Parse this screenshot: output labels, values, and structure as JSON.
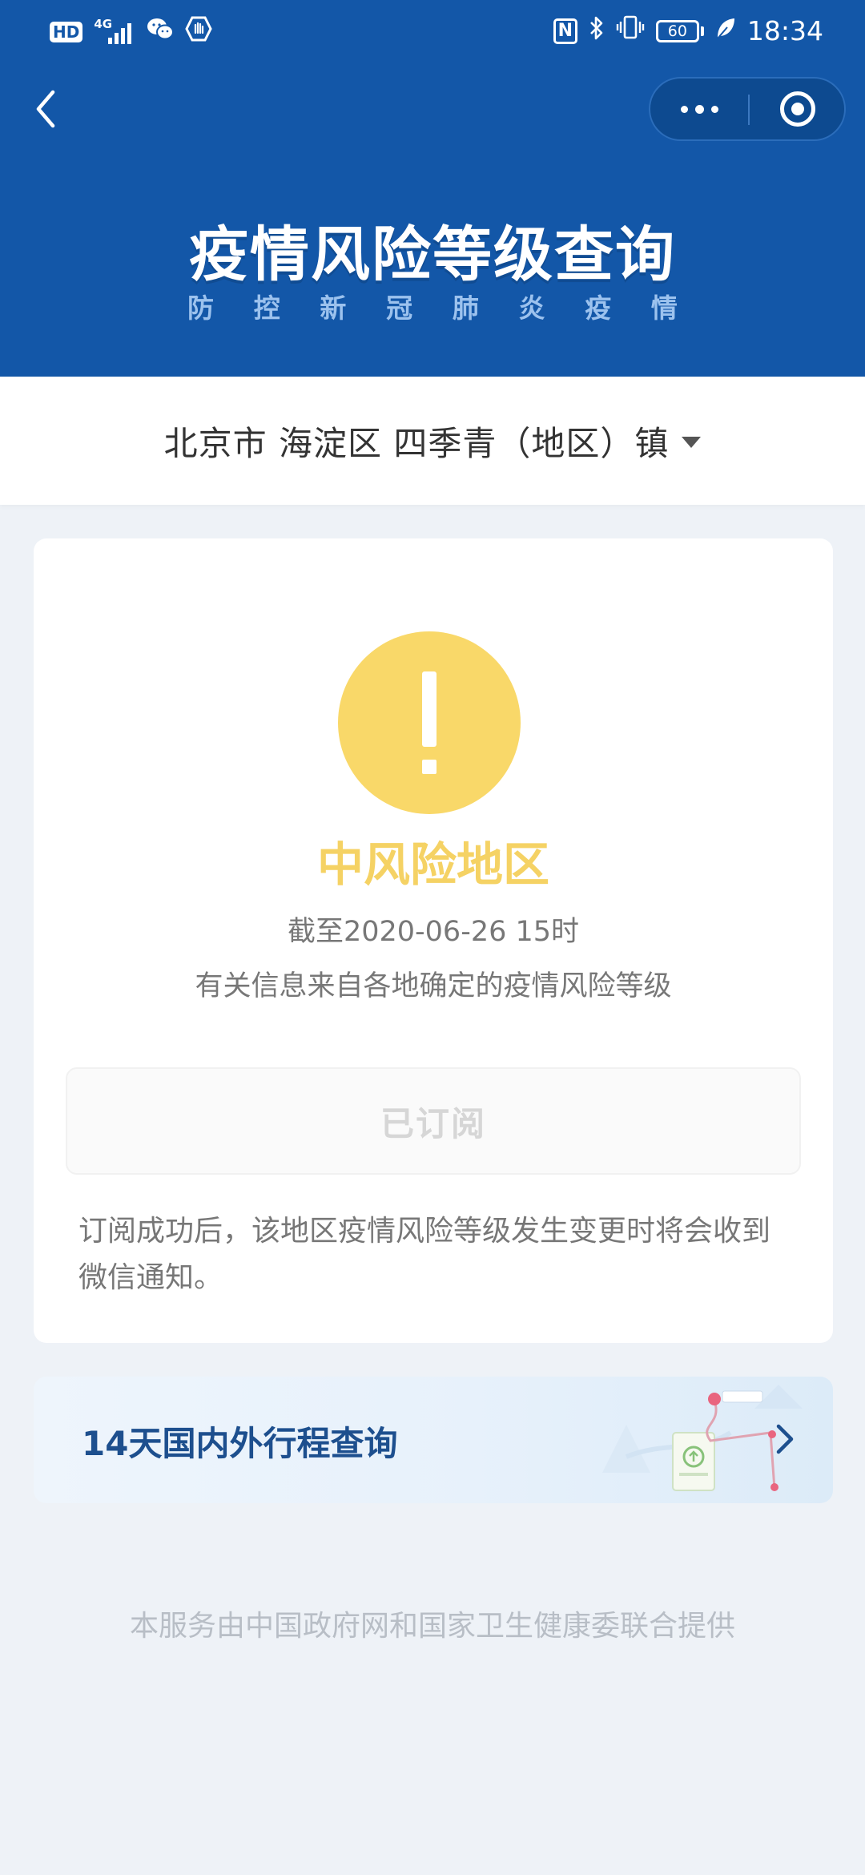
{
  "status_bar": {
    "hd": "HD",
    "network": "4G",
    "battery": "60",
    "time": "18:34"
  },
  "banner": {
    "title": "疫情风险等级查询",
    "subtitle_chars": [
      "防",
      "控",
      "新",
      "冠",
      "肺",
      "炎",
      "疫",
      "情"
    ]
  },
  "location": {
    "text": "北京市 海淀区 四季青（地区）镇"
  },
  "risk": {
    "level": "中风险地区",
    "as_of": "截至2020-06-26 15时",
    "source": "有关信息来自各地确定的疫情风险等级",
    "subscribe_label": "已订阅",
    "subscribe_note": "订阅成功后，该地区疫情风险等级发生变更时将会收到微信通知。",
    "level_color": "#f5d264"
  },
  "trip": {
    "label": "14天国内外行程查询"
  },
  "footer": {
    "note": "本服务由中国政府网和国家卫生健康委联合提供"
  },
  "colors": {
    "header_bg": "#1357a8",
    "page_bg": "#eef2f7",
    "warning_yellow": "#f9d869",
    "trip_text": "#1d4f8e"
  },
  "icons": {
    "back": "chevron-left-icon",
    "more": "more-dots-icon",
    "close": "target-close-icon",
    "warning": "exclamation-icon",
    "arrow": "chevron-right-icon"
  }
}
